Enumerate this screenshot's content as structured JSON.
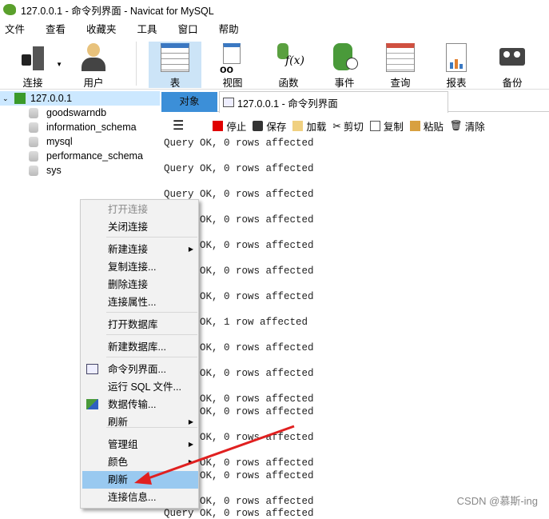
{
  "window": {
    "title": "127.0.0.1 - 命令列界面 - Navicat for MySQL"
  },
  "menu": [
    "文件",
    "查看",
    "收藏夹",
    "工具",
    "窗口",
    "帮助"
  ],
  "toolbar": [
    {
      "label": "连接",
      "icon": "plug-icon"
    },
    {
      "label": "用户",
      "icon": "user-icon"
    },
    {
      "label": "表",
      "icon": "table-icon"
    },
    {
      "label": "视图",
      "icon": "view-icon"
    },
    {
      "label": "函数",
      "icon": "function-icon"
    },
    {
      "label": "事件",
      "icon": "event-icon"
    },
    {
      "label": "查询",
      "icon": "query-icon"
    },
    {
      "label": "报表",
      "icon": "report-icon"
    },
    {
      "label": "备份",
      "icon": "backup-icon"
    }
  ],
  "tree": {
    "connection": "127.0.0.1",
    "databases": [
      "goodswarndb",
      "information_schema",
      "mysql",
      "performance_schema",
      "sys"
    ]
  },
  "tabs": {
    "objects": "对象",
    "console": "127.0.0.1 - 命令列界面"
  },
  "editor_toolbar": {
    "stop": "停止",
    "save": "保存",
    "load": "加载",
    "cut": "剪切",
    "copy": "复制",
    "paste": "粘贴",
    "clear": "清除"
  },
  "output": [
    "Query OK, 0 rows affected",
    "Query OK, 0 rows affected",
    "Query OK, 0 rows affected",
    "Query OK, 0 rows affected",
    "Query OK, 0 rows affected",
    "Query OK, 0 rows affected",
    "Query OK, 0 rows affected",
    "Query OK, 1 row affected",
    "Query OK, 0 rows affected",
    "Query OK, 0 rows affected",
    "Query OK, 0 rows affected",
    "Query OK, 0 rows affected",
    "Query OK, 0 rows affected",
    "Query OK, 0 rows affected",
    "Query OK, 0 rows affected",
    "Query OK, 0 rows affected",
    "Query OK, 0 rows affected"
  ],
  "context_menu": [
    {
      "label": "打开连接",
      "disabled": true
    },
    {
      "label": "关闭连接"
    },
    {
      "label": "新建连接",
      "submenu": true
    },
    {
      "label": "复制连接..."
    },
    {
      "label": "删除连接"
    },
    {
      "label": "连接属性..."
    },
    {
      "label": "打开数据库"
    },
    {
      "label": "新建数据库..."
    },
    {
      "label": "命令列界面..."
    },
    {
      "label": "运行 SQL 文件..."
    },
    {
      "label": "数据传输..."
    },
    {
      "label": "刷新",
      "submenu": true
    },
    {
      "label": "管理组",
      "submenu": true
    },
    {
      "label": "颜色",
      "submenu": true
    },
    {
      "label": "刷新",
      "highlighted": true
    },
    {
      "label": "连接信息..."
    }
  ],
  "watermark": "CSDN @慕斯-ing",
  "colors": {
    "accent": "#3c8fd8",
    "selection": "#cce8ff",
    "highlight": "#99c9f0",
    "arrow": "#e02020"
  }
}
